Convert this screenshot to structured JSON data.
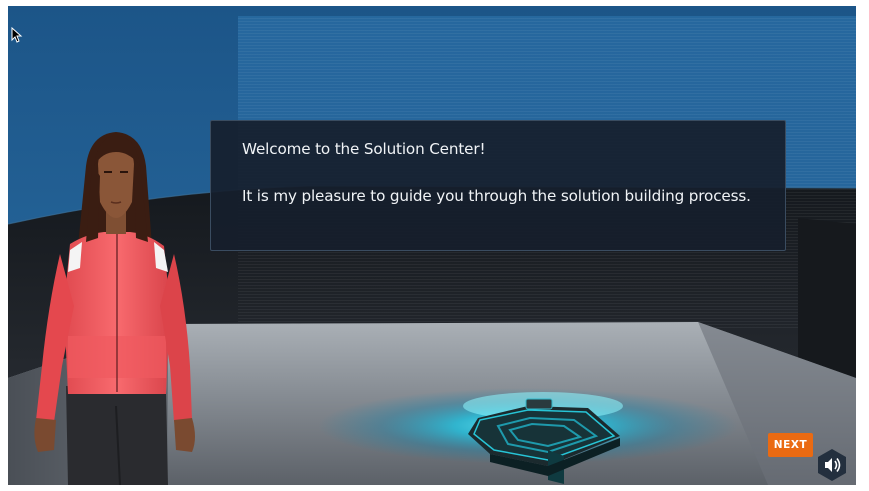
{
  "dialog": {
    "line1": "Welcome to the Solution Center!",
    "line2": "It is my pleasure to guide you through the solution building process."
  },
  "controls": {
    "next_label": "NEXT",
    "sound_icon": "speaker-volume-icon"
  },
  "colors": {
    "accent": "#ea6a12",
    "dialog_bg": "#161e2c",
    "sky": "#1f5a8a",
    "floor": "#8a8f96",
    "glow": "#22c7e0",
    "jacket": "#f0555a"
  }
}
